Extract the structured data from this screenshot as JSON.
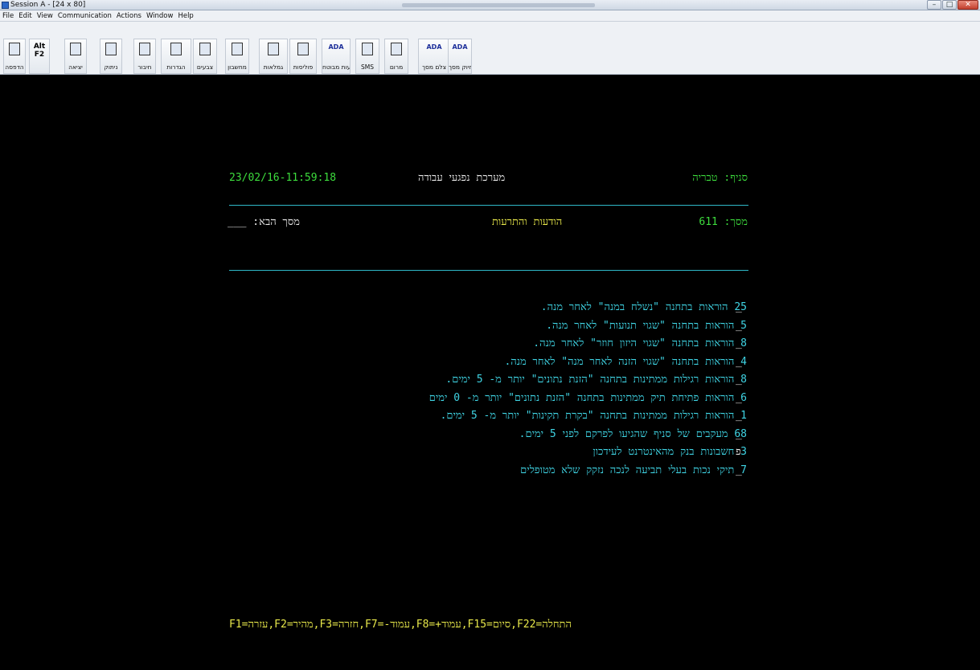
{
  "window": {
    "title": "Session A - [24 x 80]"
  },
  "menu": [
    "File",
    "Edit",
    "View",
    "Communication",
    "Actions",
    "Window",
    "Help"
  ],
  "toolbar": [
    {
      "id": "print",
      "label": "הדפסה",
      "icon": "printer-icon"
    },
    {
      "id": "altf2",
      "label": "",
      "alt": "Alt\nF2",
      "icon": "alt-f2-key"
    },
    {
      "id": "exit",
      "label": "יציאה",
      "icon": "exit-icon"
    },
    {
      "id": "disconnect",
      "label": "ניתוק",
      "icon": "disconnect-icon"
    },
    {
      "id": "connect",
      "label": "חיבור",
      "icon": "connect-icon"
    },
    {
      "id": "settings",
      "label": "הגדרות",
      "icon": "settings-icon"
    },
    {
      "id": "colors",
      "label": "צבעים",
      "icon": "colors-icon"
    },
    {
      "id": "calculator",
      "label": "מחשבון",
      "icon": "calculator-icon"
    },
    {
      "id": "benefits",
      "label": "גמלאות",
      "icon": "folder-icon"
    },
    {
      "id": "policies",
      "label": "פוליסות",
      "icon": "policy-icon"
    },
    {
      "id": "messages",
      "label": "הודעות מבוטח",
      "ada": "ADA",
      "icon": "ada-icon"
    },
    {
      "id": "sms",
      "label": "SMS",
      "icon": "sms-icon"
    },
    {
      "id": "claim",
      "label": "מרום",
      "icon": "checklist-icon"
    },
    {
      "id": "screenshot",
      "label": "צלם מסך",
      "ada": "ADA",
      "icon": "ada-icon"
    },
    {
      "id": "delscreen",
      "label": "חיוק מסך",
      "ada": "ADA",
      "icon": "ada-icon"
    }
  ],
  "terminal": {
    "datetime": "23/02/16-11:59:18",
    "system": "מערכת נפגעי עבודה",
    "branch": "סניף: טבריה",
    "next_screen": "___ :מסך הבא",
    "screen_title": "הודעות והתרעות",
    "screen_num": "מסך: 611",
    "lines": [
      {
        "sel": "_",
        "text": "25  הוראות בתחנה \"נשלח במנה\"  לאחר מנה."
      },
      {
        "sel": "_",
        "text": "5  הוראות בתחנה \"שגוי תנועות\"  לאחר מנה."
      },
      {
        "sel": "_",
        "text": "8  הוראות בתחנה \"שגוי היזון חוזר\"  לאחר מנה."
      },
      {
        "sel": "_",
        "text": "4  הוראות בתחנה \"שגוי הזנה לאחר מנה\"  לאחר מנה."
      },
      {
        "sel": "_",
        "text": "8  הוראות רגילות ממתינות בתחנה \"הזנת נתונים\" יותר מ-  5  ימים."
      },
      {
        "sel": "_",
        "text": "6  הוראות פתיחת תיק ממתינות בתחנה \"הזנת נתונים\" יותר מ-  0  ימים"
      },
      {
        "sel": "_",
        "text": "1  הוראות רגילות ממתינות בתחנה \"בקרת תקינות\" יותר מ-  5  ימים."
      },
      {
        "sel": "_",
        "text": "68 מעקבים של סניף שהגיעו לפרקם לפני 5 ימים."
      },
      {
        "sel": "פ",
        "text": "3  חשבונות בנק מהאינטרנט לעידכון"
      },
      {
        "sel": "_",
        "text": "7  תיקי נכות בעלי תביעה לנכה נזקק שלא מטופלים"
      }
    ],
    "fkeys": "F1=עזרה,F2=מהיר,F3=חזרה,F7=-עמוד,F8=+עמוד,F15=סיום,F22=התחלה"
  }
}
